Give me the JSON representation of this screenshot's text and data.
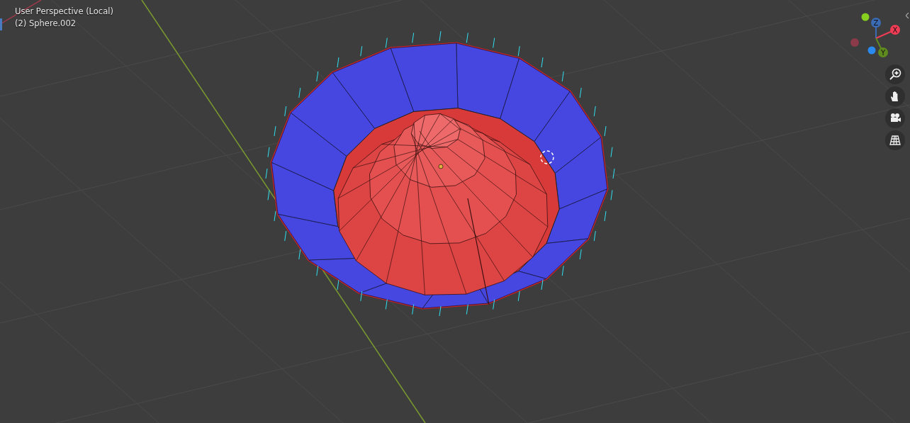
{
  "viewport": {
    "view_name": "User Perspective (Local)",
    "object_info": "(2) Sphere.002"
  },
  "gizmo": {
    "axes": [
      {
        "label": "Z",
        "color": "#3b6bb5"
      },
      {
        "label": "X",
        "color": "#f03c55"
      },
      {
        "label": "Y",
        "color": "#5f8a1e"
      }
    ]
  }
}
